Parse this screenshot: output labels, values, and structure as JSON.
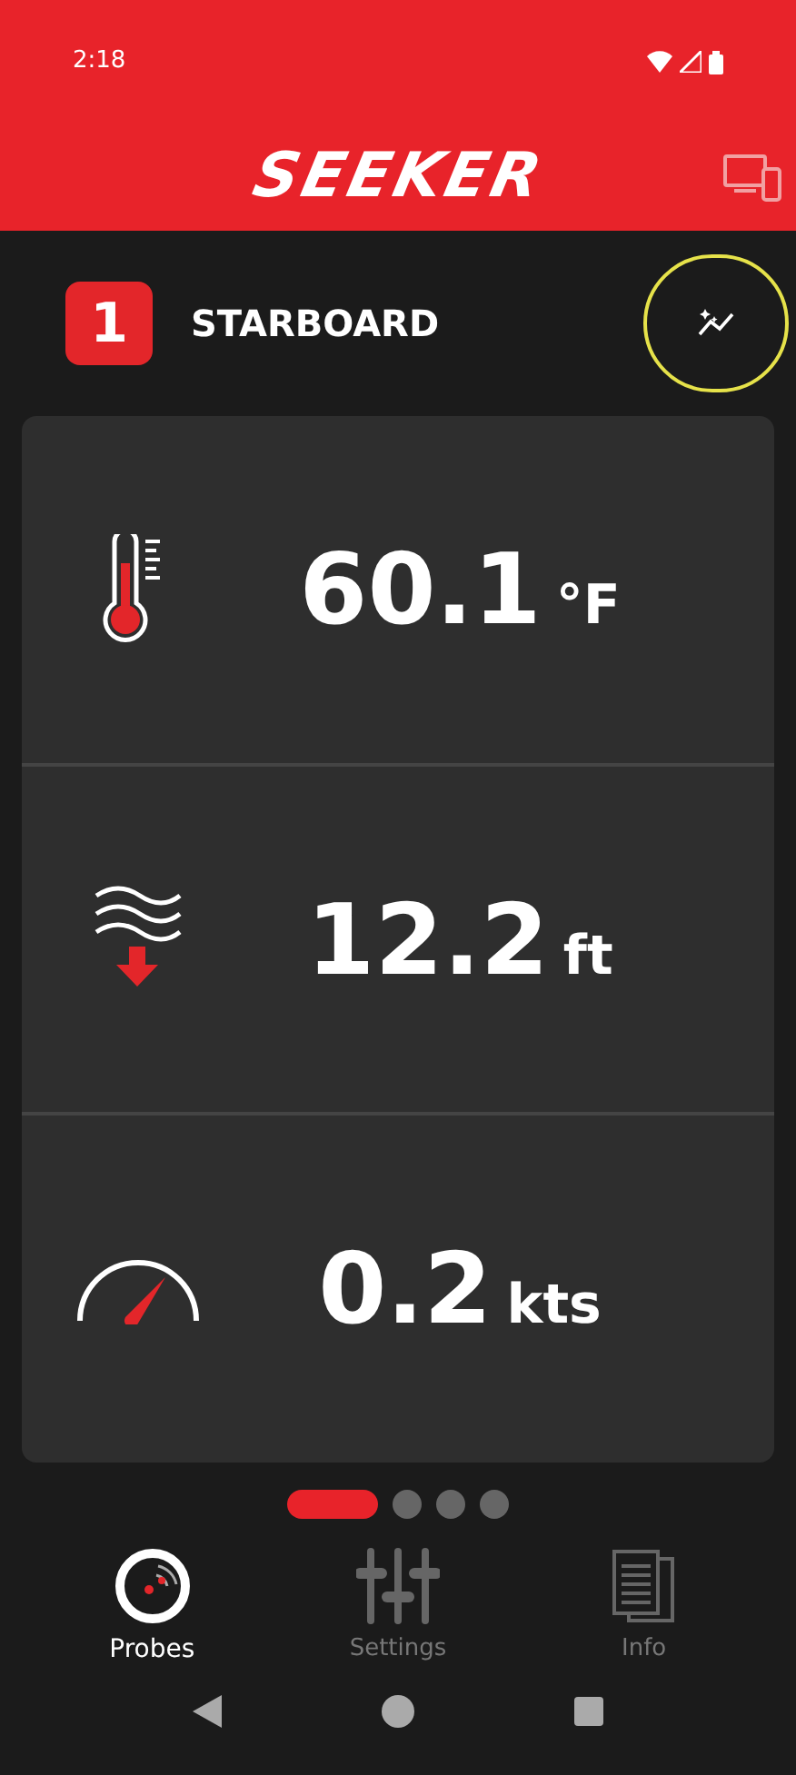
{
  "status_bar": {
    "time": "2:18"
  },
  "header": {
    "logo": "SEEKER"
  },
  "probe": {
    "number": "1",
    "name": "STARBOARD",
    "trend_button": {
      "highlighted": true
    }
  },
  "readings": [
    {
      "kind": "temperature",
      "value": "60.1",
      "unit": "°F"
    },
    {
      "kind": "depth",
      "value": "12.2",
      "unit": "ft"
    },
    {
      "kind": "speed",
      "value": "0.2",
      "unit": "kts"
    }
  ],
  "pager": [
    {
      "selected": true
    },
    {
      "selected": false
    },
    {
      "selected": false
    },
    {
      "selected": false
    }
  ],
  "tabs": [
    {
      "kind": "probes",
      "label": "Probes",
      "selected": true
    },
    {
      "kind": "settings",
      "label": "Settings",
      "selected": false
    },
    {
      "kind": "info",
      "label": "Info",
      "selected": false
    }
  ]
}
